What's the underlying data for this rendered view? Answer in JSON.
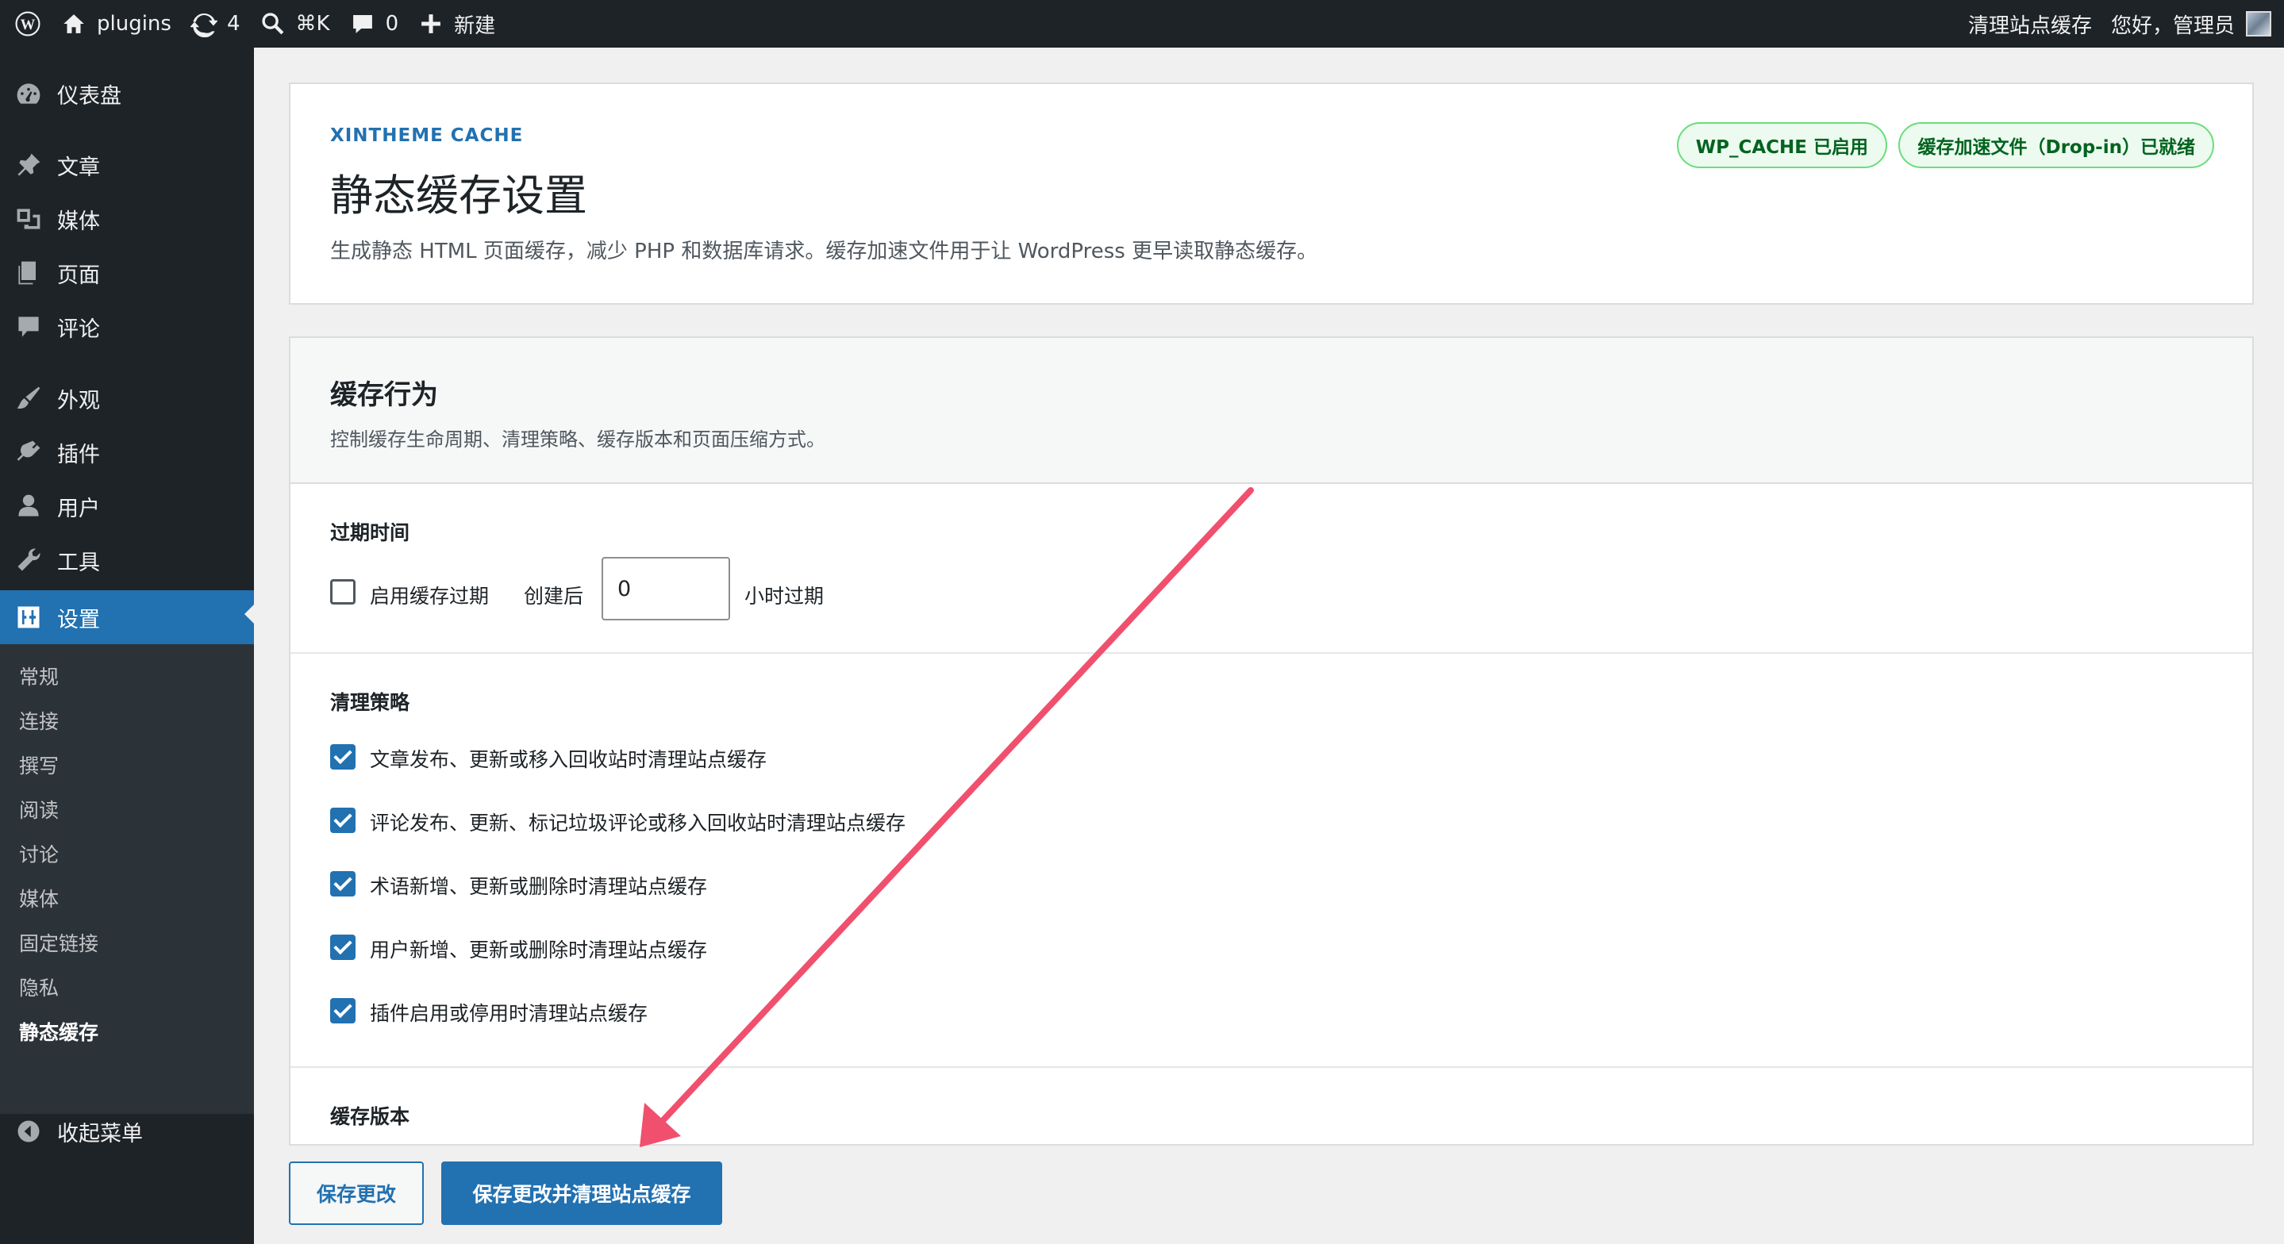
{
  "adminbar": {
    "site_name": "plugins",
    "updates_count": "4",
    "search_shortcut": "⌘K",
    "comments_count": "0",
    "new_label": "新建",
    "clear_cache_label": "清理站点缓存",
    "greeting": "您好，管理员"
  },
  "sidebar": {
    "dashboard": "仪表盘",
    "posts": "文章",
    "media": "媒体",
    "pages": "页面",
    "comments": "评论",
    "appearance": "外观",
    "plugins": "插件",
    "users": "用户",
    "tools": "工具",
    "settings": "设置",
    "collapse": "收起菜单",
    "submenu": [
      "常规",
      "连接",
      "撰写",
      "阅读",
      "讨论",
      "媒体",
      "固定链接",
      "隐私",
      "静态缓存"
    ]
  },
  "header": {
    "eyebrow": "XINTHEME CACHE",
    "title": "静态缓存设置",
    "description": "生成静态 HTML 页面缓存，减少 PHP 和数据库请求。缓存加速文件用于让 WordPress 更早读取静态缓存。",
    "badge_wp_cache": "WP_CACHE 已启用",
    "badge_dropin": "缓存加速文件（Drop-in）已就绪"
  },
  "behavior": {
    "title": "缓存行为",
    "description": "控制缓存生命周期、清理策略、缓存版本和页面压缩方式。",
    "expiry": {
      "label": "过期时间",
      "enable_label": "启用缓存过期",
      "after_label": "创建后",
      "hours_value": "0",
      "hours_suffix": "小时过期",
      "enabled": false
    },
    "purge": {
      "label": "清理策略",
      "options": [
        "文章发布、更新或移入回收站时清理站点缓存",
        "评论发布、更新、标记垃圾评论或移入回收站时清理站点缓存",
        "术语新增、更新或删除时清理站点缓存",
        "用户新增、更新或删除时清理站点缓存",
        "插件启用或停用时清理站点缓存"
      ],
      "checked": [
        true,
        true,
        true,
        true,
        true
      ]
    },
    "version_label": "缓存版本"
  },
  "buttons": {
    "save": "保存更改",
    "save_and_clear": "保存更改并清理站点缓存"
  },
  "colors": {
    "accent": "#2271b1",
    "adminbar": "#1d2327",
    "annotation_arrow": "#f0506e"
  }
}
